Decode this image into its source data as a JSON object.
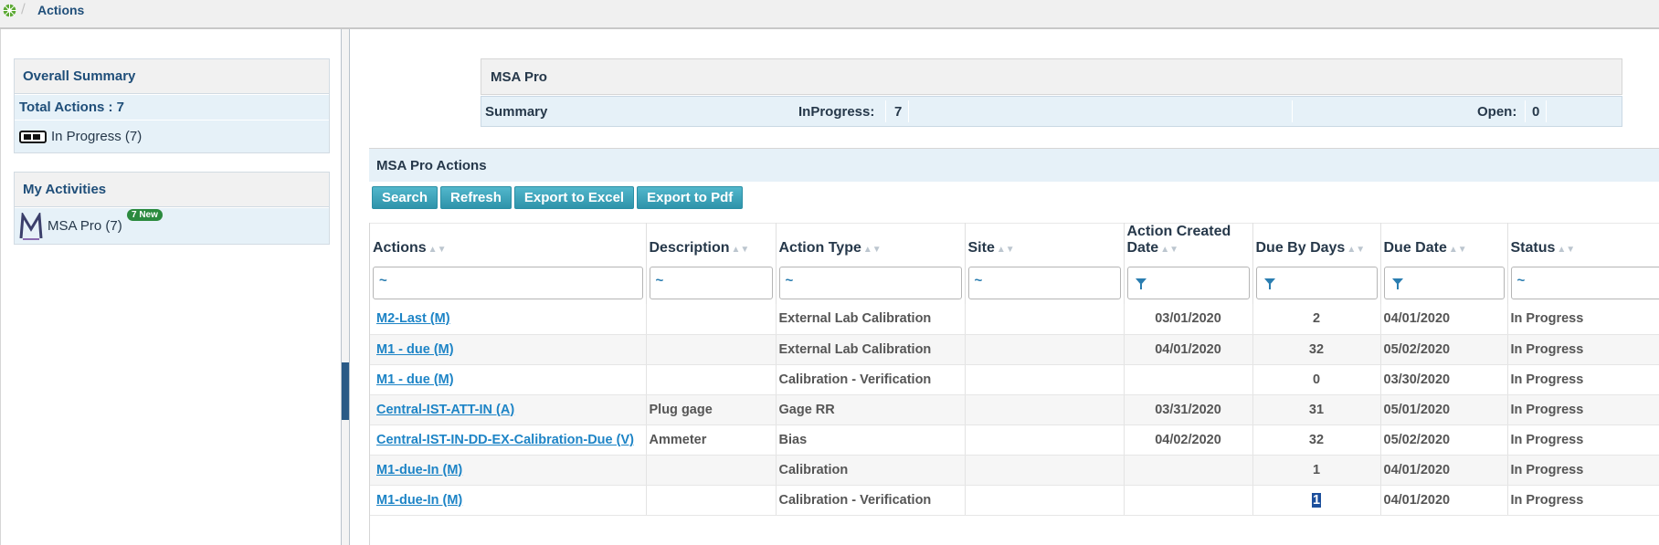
{
  "breadcrumb": {
    "current": "Actions"
  },
  "left": {
    "overall_summary": {
      "title": "Overall Summary",
      "total_actions": "Total Actions : 7",
      "in_progress": "In Progress (7)"
    },
    "my_activities": {
      "title": "My Activities",
      "item_label": "MSA Pro (7)",
      "badge": "7 New"
    }
  },
  "main": {
    "module_title": "MSA Pro",
    "summary": {
      "label": "Summary",
      "inprogress_label": "InProgress:",
      "inprogress_value": "7",
      "open_label": "Open:",
      "open_value": "0"
    },
    "actions_title": "MSA Pro Actions",
    "toolbar": {
      "search": "Search",
      "refresh": "Refresh",
      "export_excel": "Export to Excel",
      "export_pdf": "Export to Pdf"
    },
    "columns": {
      "actions": "Actions",
      "description": "Description",
      "action_type": "Action Type",
      "site": "Site",
      "created_line1": "Action Created",
      "created_line2": "Date",
      "due_by_days": "Due By Days",
      "due_date": "Due Date",
      "status": "Status"
    },
    "filter_symbol": "~",
    "rows": [
      {
        "action": "M2-Last (M)",
        "description": "",
        "type": "External Lab Calibration",
        "site": "",
        "created": "03/01/2020",
        "due_days": "2",
        "due_date": "04/01/2020",
        "status": "In Progress"
      },
      {
        "action": "M1 - due (M)",
        "description": "",
        "type": "External Lab Calibration",
        "site": "",
        "created": "04/01/2020",
        "due_days": "32",
        "due_date": "05/02/2020",
        "status": "In Progress"
      },
      {
        "action": "M1 - due (M)",
        "description": "",
        "type": "Calibration - Verification",
        "site": "",
        "created": "",
        "due_days": "0",
        "due_date": "03/30/2020",
        "status": "In Progress"
      },
      {
        "action": "Central-IST-ATT-IN (A)",
        "description": "Plug gage",
        "type": "Gage RR",
        "site": "",
        "created": "03/31/2020",
        "due_days": "31",
        "due_date": "05/01/2020",
        "status": "In Progress"
      },
      {
        "action": "Central-IST-IN-DD-EX-Calibration-Due (V)",
        "description": "Ammeter",
        "type": "Bias",
        "site": "",
        "created": "04/02/2020",
        "due_days": "32",
        "due_date": "05/02/2020",
        "status": "In Progress"
      },
      {
        "action": "M1-due-In (M)",
        "description": "",
        "type": "Calibration",
        "site": "",
        "created": "",
        "due_days": "1",
        "due_date": "04/01/2020",
        "status": "In Progress"
      },
      {
        "action": "M1-due-In (M)",
        "description": "",
        "type": "Calibration - Verification",
        "site": "",
        "created": "",
        "due_days": "1",
        "due_date": "04/01/2020",
        "status": "In Progress"
      }
    ]
  },
  "colors": {
    "brand_blue": "#1f4e79",
    "link": "#1d84c6",
    "button": "#3aa3ba",
    "overdue": "#e00000",
    "badge": "#2b8a3e"
  },
  "icons": [
    "home-icon",
    "progress-icon",
    "msa-logo-icon",
    "sort-icon",
    "filter-icon"
  ]
}
